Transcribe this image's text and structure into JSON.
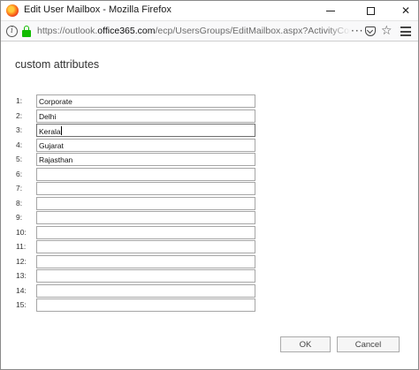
{
  "window": {
    "title": "Edit User Mailbox - Mozilla Firefox"
  },
  "urlbar": {
    "url_prefix": "https://outlook.",
    "url_host": "office365.com",
    "url_path": "/ecp/UsersGroups/EditMailbox.aspx?ActivityCorrelationI"
  },
  "content": {
    "heading": "custom attributes",
    "rows": [
      {
        "label": "1:",
        "value": "Corporate"
      },
      {
        "label": "2:",
        "value": "Delhi"
      },
      {
        "label": "3:",
        "value": "Kerala"
      },
      {
        "label": "4:",
        "value": "Gujarat"
      },
      {
        "label": "5:",
        "value": "Rajasthan"
      },
      {
        "label": "6:",
        "value": ""
      },
      {
        "label": "7:",
        "value": ""
      },
      {
        "label": "8:",
        "value": ""
      },
      {
        "label": "9:",
        "value": ""
      },
      {
        "label": "10:",
        "value": ""
      },
      {
        "label": "11:",
        "value": ""
      },
      {
        "label": "12:",
        "value": ""
      },
      {
        "label": "13:",
        "value": ""
      },
      {
        "label": "14:",
        "value": ""
      },
      {
        "label": "15:",
        "value": ""
      }
    ],
    "focused_row": "3:"
  },
  "buttons": {
    "ok_label": "OK",
    "cancel_label": "Cancel"
  },
  "icons": {
    "browser": "firefox-icon",
    "info": "info-icon",
    "lock": "lock-icon",
    "page_actions": "more-dots-icon",
    "pocket": "pocket-icon",
    "bookmark": "star-icon",
    "menu": "hamburger-menu-icon"
  },
  "colors": {
    "lock": "#12bc00"
  }
}
